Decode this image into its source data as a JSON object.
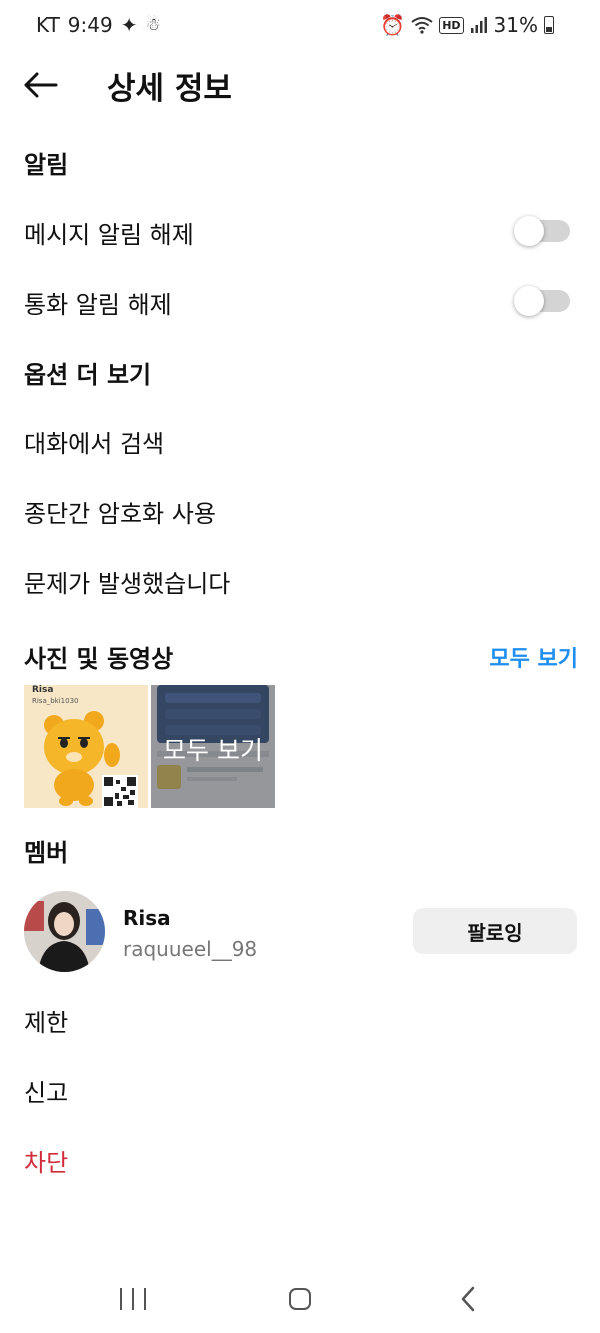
{
  "status_bar": {
    "carrier": "KT",
    "time": "9:49",
    "network_badge": "HD",
    "battery": "31%"
  },
  "header": {
    "title": "상세 정보"
  },
  "notifications": {
    "title": "알림",
    "mute_messages_label": "메시지 알림 해제",
    "mute_messages_on": false,
    "mute_calls_label": "통화 알림 해제",
    "mute_calls_on": false
  },
  "more_options": {
    "title": "옵션 더 보기",
    "items": [
      "대화에서 검색",
      "종단간 암호화 사용",
      "문제가 발생했습니다"
    ]
  },
  "media": {
    "title": "사진 및 동영상",
    "see_all_link": "모두 보기",
    "thumb_overlay_label": "모두 보기",
    "thumb1_caption_name": "Risa",
    "thumb1_caption_id": "Risa_bki1030"
  },
  "members": {
    "title": "멤버",
    "items": [
      {
        "name": "Risa",
        "username": "raquueel__98",
        "follow_label": "팔로잉"
      }
    ]
  },
  "actions": {
    "restrict": "제한",
    "report": "신고",
    "block": "차단"
  },
  "colors": {
    "link_blue": "#1f8ef1",
    "danger_red": "#d12c3a",
    "toggle_track": "#d4d4d4"
  }
}
